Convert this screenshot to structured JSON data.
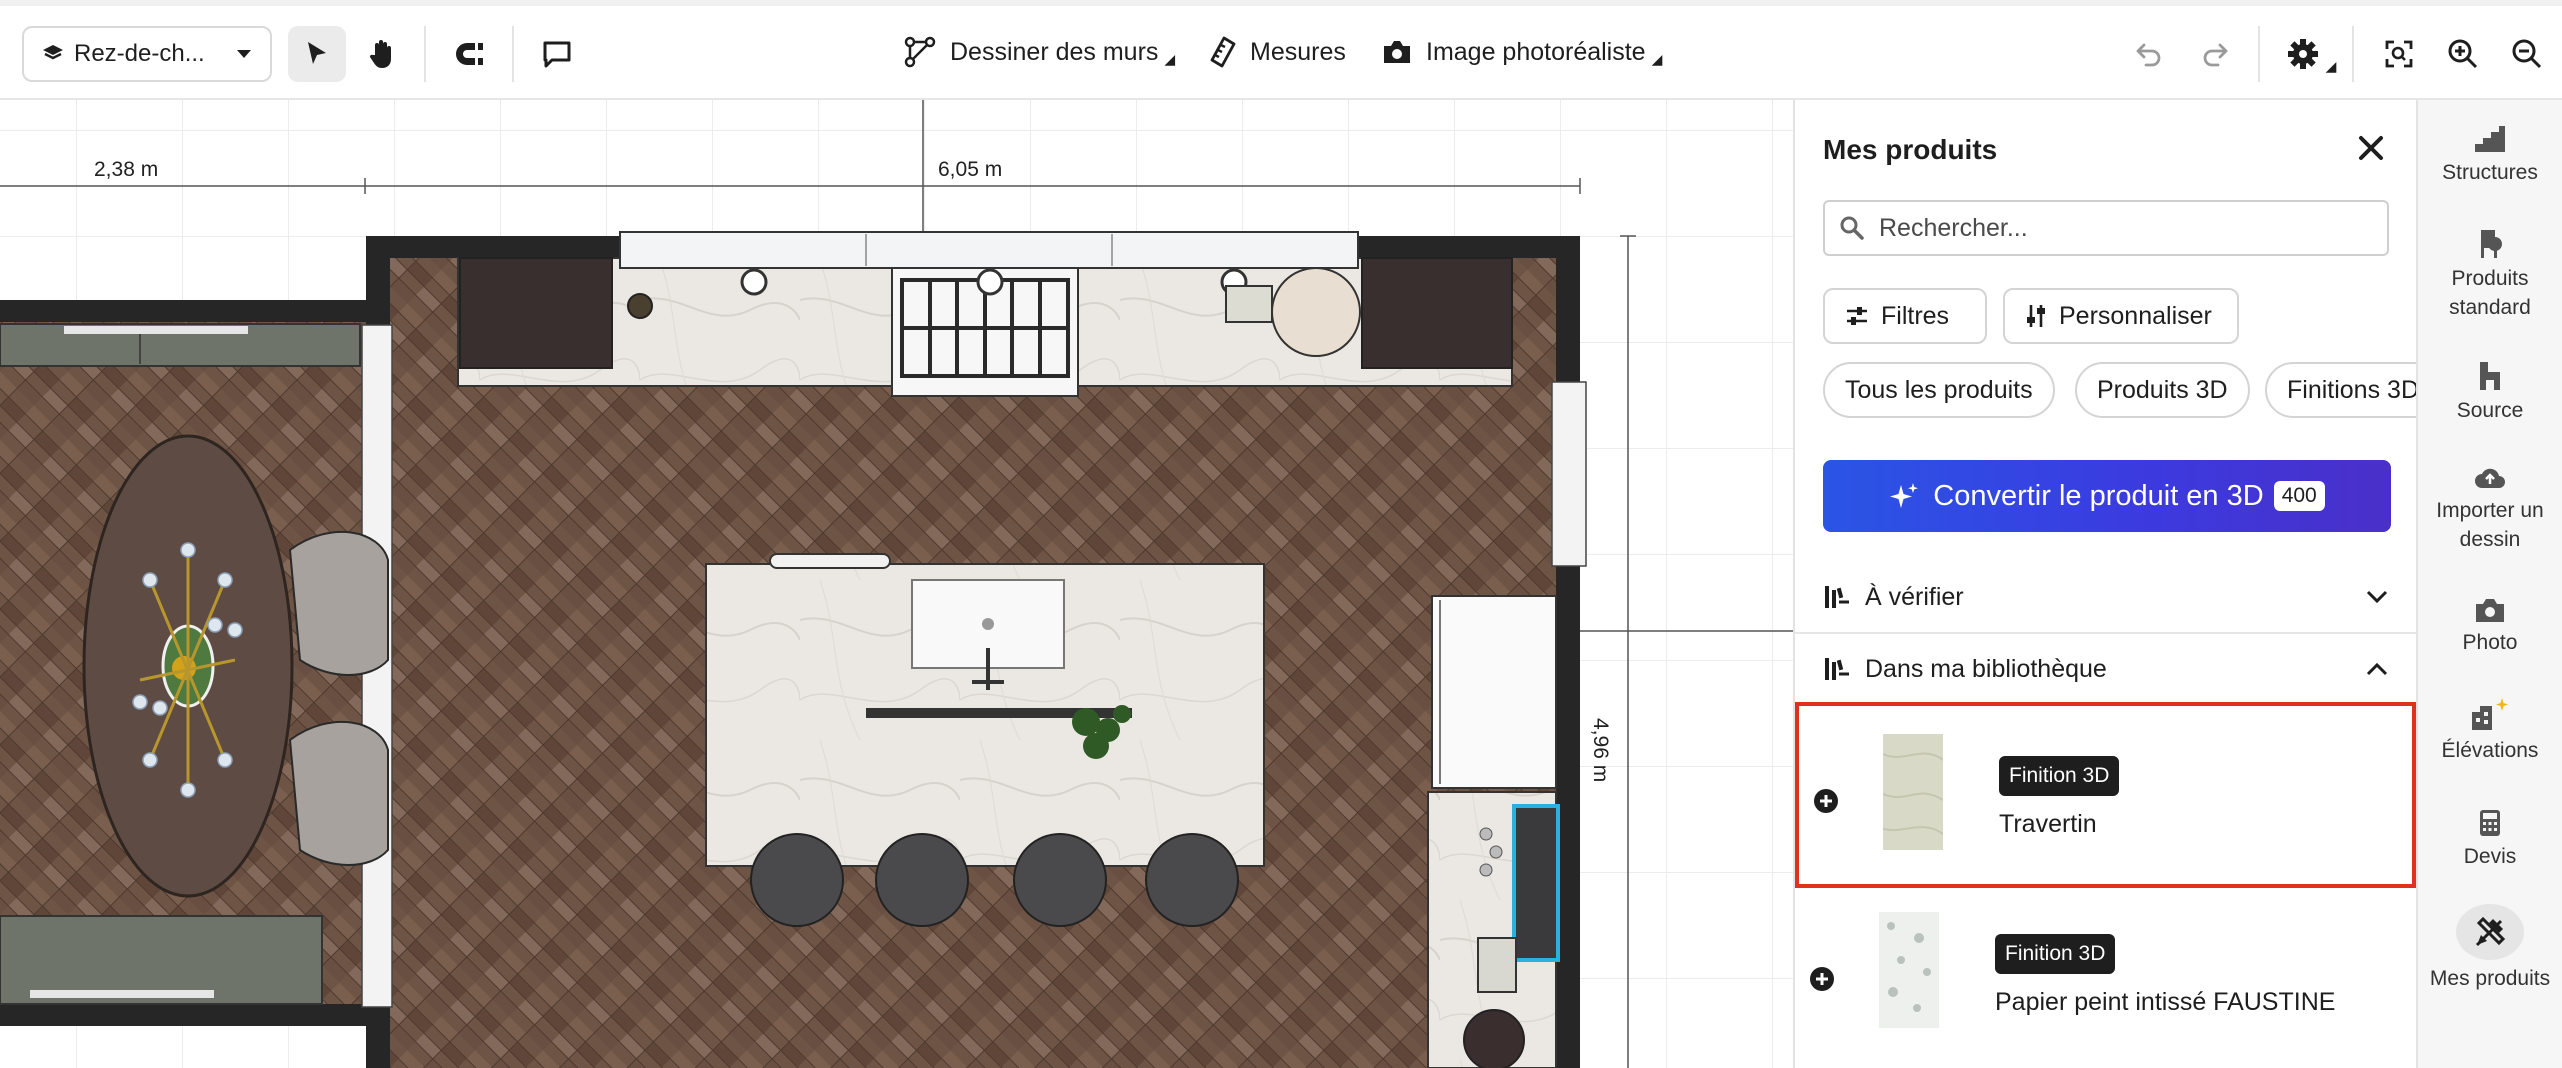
{
  "toolbar": {
    "level_select": "Rez-de-ch...",
    "draw_walls": "Dessiner des murs",
    "measures": "Mesures",
    "photo_render": "Image photoréaliste"
  },
  "canvas": {
    "dimensions": {
      "left_width": "2,38 m",
      "top_width": "6,05 m",
      "right_height": "4,96 m"
    }
  },
  "panel": {
    "title": "Mes produits",
    "search_placeholder": "Rechercher...",
    "filters_label": "Filtres",
    "customize_label": "Personnaliser",
    "chips": [
      "Tous les produits",
      "Produits 3D",
      "Finitions 3D"
    ],
    "convert_label": "Convertir le produit en 3D",
    "convert_count": "400",
    "sections": {
      "to_check": "À vérifier",
      "library": "Dans ma bibliothèque"
    },
    "products": [
      {
        "badge": "Finition 3D",
        "name": "Travertin",
        "selected": true
      },
      {
        "badge": "Finition 3D",
        "name": "Papier peint intissé FAUSTINE",
        "selected": false
      }
    ]
  },
  "sidebar": {
    "items": [
      {
        "label": "Structures",
        "icon": "stairs-icon"
      },
      {
        "label": "Produits standard",
        "icon": "chair-icon"
      },
      {
        "label": "Source",
        "icon": "source-icon"
      },
      {
        "label": "Importer un dessin",
        "icon": "cloud-upload-icon"
      },
      {
        "label": "Photo",
        "icon": "camera-icon"
      },
      {
        "label": "Élévations",
        "icon": "elevation-icon"
      },
      {
        "label": "Devis",
        "icon": "calculator-icon"
      },
      {
        "label": "Mes produits",
        "icon": "my-products-icon"
      }
    ]
  },
  "colors": {
    "accent": "#2f4be0",
    "selection": "#e0301e",
    "badge": "#1e1e1e"
  }
}
